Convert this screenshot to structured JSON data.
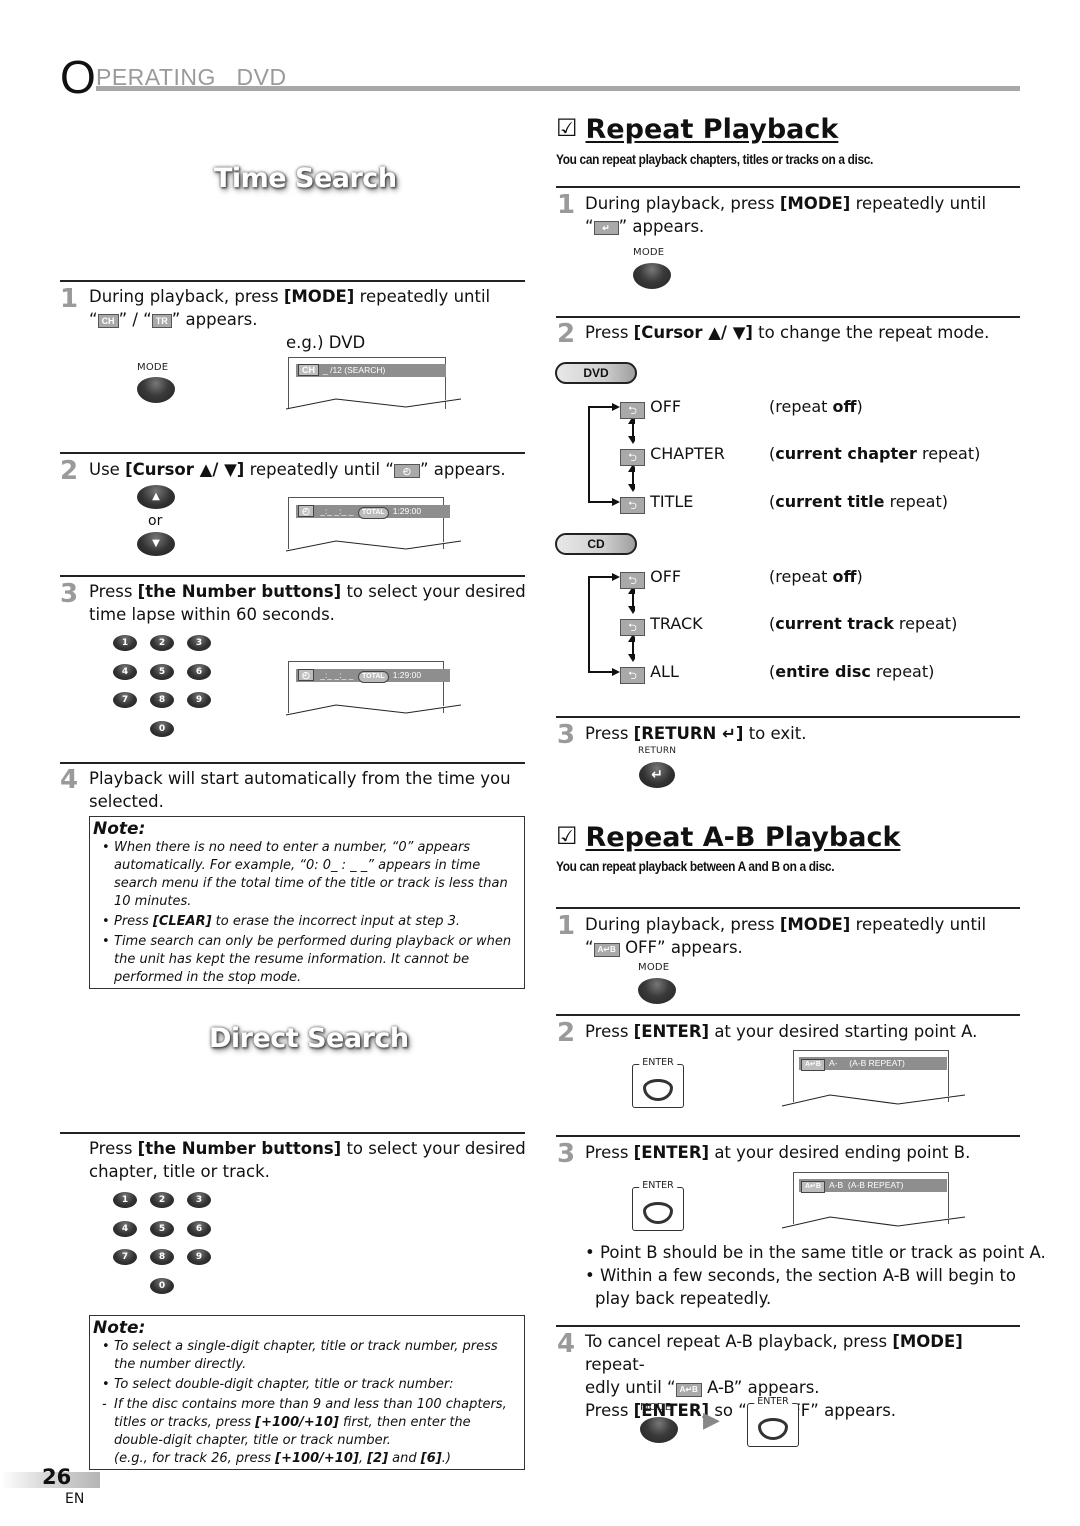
{
  "header": {
    "first_letter": "O",
    "rest": "PERATING   DVD"
  },
  "left": {
    "time_search": {
      "title": "Time Search",
      "steps": [
        {
          "num": "1",
          "line1_pre": "During playback, press ",
          "line1_bold": "[MODE]",
          "line1_post": " repeatedly until",
          "line2_q1": "“",
          "icon_ch": "CH",
          "line2_mid": "” / “",
          "icon_tr": "TR",
          "line2_post": "” appears.",
          "eg_label": "e.g.) DVD",
          "button_label": "MODE",
          "osd": {
            "tag": "CH",
            "text": "_ /12 (SEARCH)"
          }
        },
        {
          "num": "2",
          "pre": "Use ",
          "bold": "[Cursor ▲/ ▼]",
          "post1": " repeatedly until “",
          "icon": "◴",
          "post2": "” appears.",
          "up_glyph": "▲",
          "or_label": "or",
          "down_glyph": "▼",
          "osd": {
            "tag": "◴",
            "text": " _:_ _:_ _  ",
            "total": "TOTAL",
            "time": "1:29:00"
          }
        },
        {
          "num": "3",
          "pre": "Press ",
          "bold": "[the Number buttons]",
          "post": " to select your desired",
          "line2": "time lapse within 60 seconds.",
          "keys": [
            "1",
            "2",
            "3",
            "4",
            "5",
            "6",
            "7",
            "8",
            "9",
            "0"
          ],
          "osd": {
            "tag": "◴",
            "text": " _:_ _:_ _  ",
            "total": "TOTAL",
            "time": "1:29:00"
          }
        },
        {
          "num": "4",
          "line1": "Playback will start automatically from the time you",
          "line2": "selected."
        }
      ],
      "note": {
        "title": "Note:",
        "items": [
          "When there is no need to enter a number, “0” appears automatically. For example, “0: 0_ : _ _” appears in time search menu if the total time of the title or track is less than 10 minutes.",
          {
            "pre": "Press ",
            "bold": "[CLEAR]",
            "post": " to erase the incorrect input at step 3."
          },
          "Time search can only be performed during playback or when the unit has kept the resume information. It cannot be performed in the stop mode."
        ]
      }
    },
    "direct_search": {
      "title": "Direct Search",
      "step": {
        "pre": "Press ",
        "bold": "[the Number buttons]",
        "post": " to select your desired",
        "line2": "chapter, title or track."
      },
      "keys": [
        "1",
        "2",
        "3",
        "4",
        "5",
        "6",
        "7",
        "8",
        "9",
        "0"
      ],
      "note": {
        "title": "Note:",
        "item1": "To select a single-digit chapter, title or track number, press the number directly.",
        "item2": "To select double-digit chapter, title or track number:",
        "item3_pre": "If the disc contains more than 9 and less than 100 chapters, titles or tracks, press ",
        "item3_bold": "[+100/+10]",
        "item3_post": " first, then enter the double-digit chapter, title or track number.",
        "item4_pre": "(e.g., for track 26, press ",
        "item4_b1": "[+100/+10]",
        "item4_sep1": ", ",
        "item4_b2": "[2]",
        "item4_sep2": " and ",
        "item4_b3": "[6]",
        "item4_post": ".)"
      }
    }
  },
  "right": {
    "repeat": {
      "checkbox": "☑",
      "title": "Repeat Playback",
      "subtitle": "You can repeat playback chapters, titles or tracks on a disc.",
      "step1": {
        "num": "1",
        "pre": "During playback, press ",
        "bold": "[MODE]",
        "post": " repeatedly until",
        "line2_pre": "“",
        "icon": "↵",
        "line2_post": "” appears.",
        "button_label": "MODE"
      },
      "step2": {
        "num": "2",
        "pre": "Press ",
        "bold": "[Cursor ▲/ ▼]",
        "post": " to change the repeat mode."
      },
      "dvd": {
        "label": "DVD",
        "modes": [
          {
            "name": "OFF",
            "desc_pre": "(repeat ",
            "desc_bold": "off",
            "desc_post": ")"
          },
          {
            "name": "CHAPTER",
            "desc_pre": "(",
            "desc_bold": "current chapter",
            "desc_post": " repeat)"
          },
          {
            "name": "TITLE",
            "desc_pre": "(",
            "desc_bold": "current title",
            "desc_post": " repeat)"
          }
        ]
      },
      "cd": {
        "label": "CD",
        "modes": [
          {
            "name": "OFF",
            "desc_pre": "(repeat ",
            "desc_bold": "off",
            "desc_post": ")"
          },
          {
            "name": "TRACK",
            "desc_pre": "(",
            "desc_bold": "current track",
            "desc_post": " repeat)"
          },
          {
            "name": "ALL",
            "desc_pre": "(",
            "desc_bold": "entire disc",
            "desc_post": " repeat)"
          }
        ]
      },
      "step3": {
        "num": "3",
        "pre": "Press ",
        "bold": "[RETURN ↵]",
        "post": " to exit.",
        "button_label": "RETURN",
        "button_glyph": "↵"
      }
    },
    "ab": {
      "checkbox": "☑",
      "title": "Repeat A-B Playback",
      "subtitle": "You can repeat playback between A and B on a disc.",
      "step1": {
        "num": "1",
        "pre": "During playback, press ",
        "bold": "[MODE]",
        "post": " repeatedly until",
        "line2_pre": "“",
        "icon": "A↵B",
        "line2_post": " OFF” appears.",
        "button_label": "MODE"
      },
      "step2": {
        "num": "2",
        "pre": "Press ",
        "bold": "[ENTER]",
        "post": " at your desired starting point A.",
        "button_label": "ENTER",
        "osd": {
          "tag": "A↵B",
          "text": "A-     (A-B REPEAT)"
        }
      },
      "step3": {
        "num": "3",
        "pre": "Press ",
        "bold": "[ENTER]",
        "post": " at your desired ending point B.",
        "button_label": "ENTER",
        "osd": {
          "tag": "A↵B",
          "text": "A-B  (A-B REPEAT)"
        }
      },
      "bullets": [
        "Point B should be in the same title or track as point A.",
        "Within a few seconds, the section A-B will begin to",
        "play back repeatedly."
      ],
      "step4": {
        "num": "4",
        "pre": "To cancel repeat A-B playback, press ",
        "bold": "[MODE]",
        "post": " repeat-",
        "line2_pre": "edly until “",
        "icon": "A↵B",
        "line2_post": " A-B” appears.",
        "line3_pre": "Press ",
        "line3_bold": "[ENTER]",
        "line3_mid": " so “",
        "line3_post": " OFF” appears.",
        "mode_label": "MODE",
        "enter_label": "ENTER",
        "arrow": "▶"
      }
    }
  },
  "footer": {
    "page_number": "26",
    "language": "EN"
  }
}
